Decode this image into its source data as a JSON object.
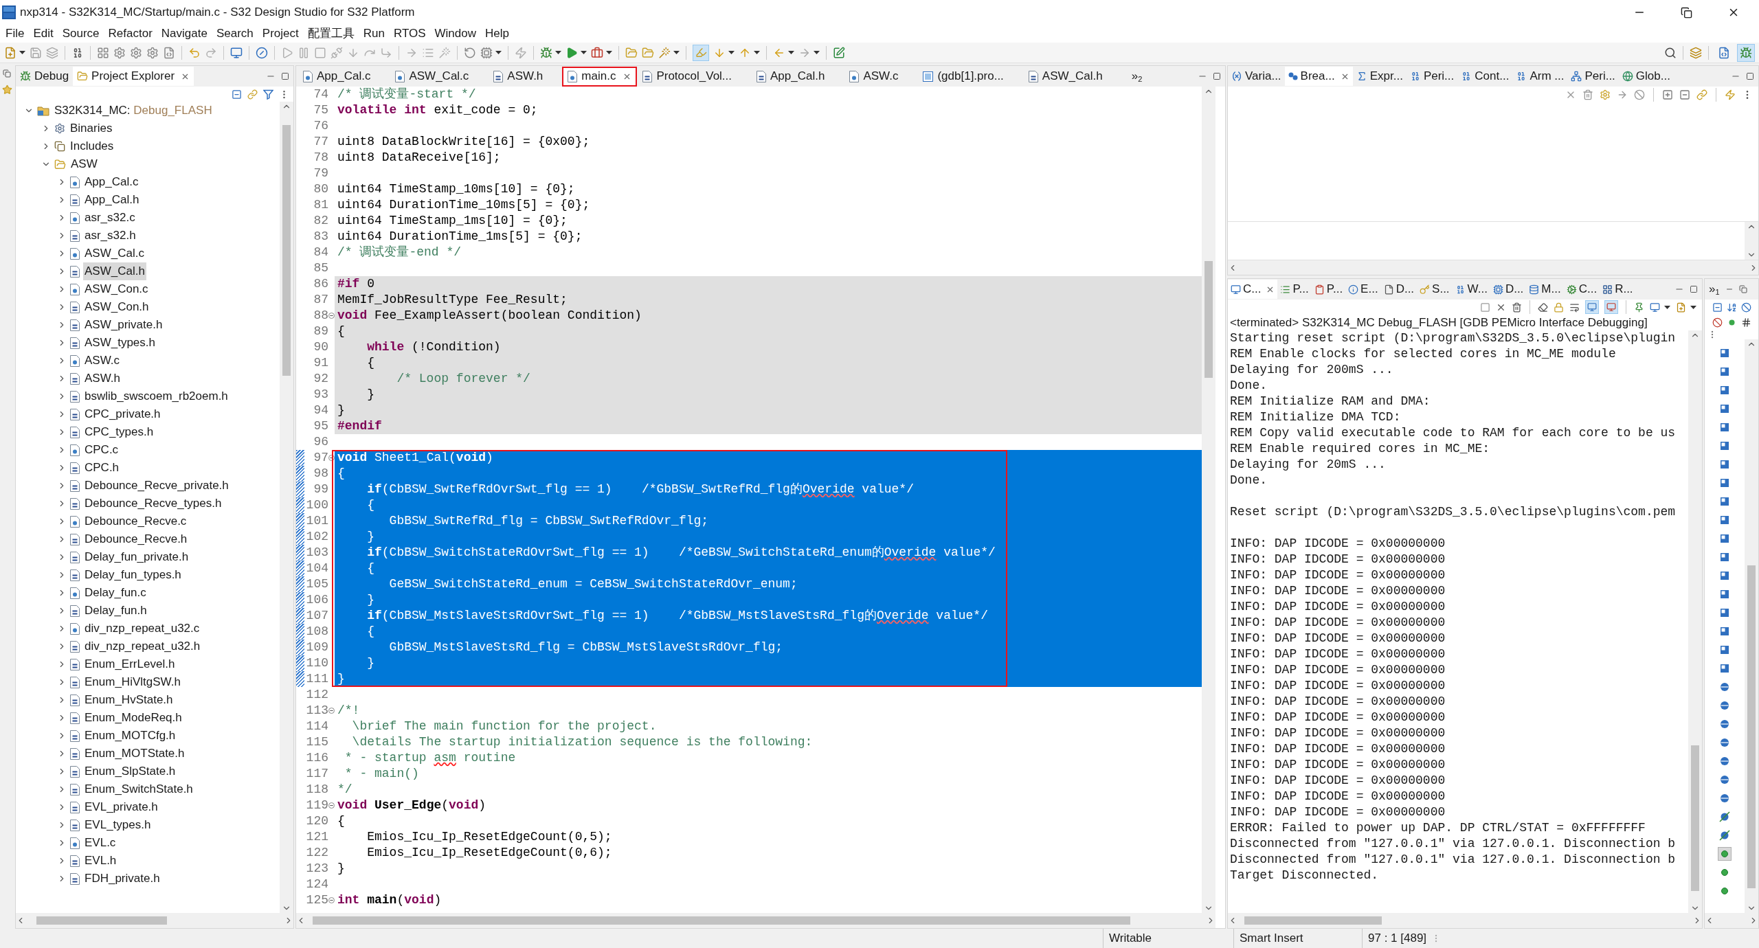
{
  "window": {
    "title": "nxp314 - S32K314_MC/Startup/main.c - S32 Design Studio for S32 Platform"
  },
  "menu": [
    "File",
    "Edit",
    "Source",
    "Refactor",
    "Navigate",
    "Search",
    "Project",
    "配置工具",
    "Run",
    "RTOS",
    "Window",
    "Help"
  ],
  "toolbar": {
    "highlight_toggle": {
      "on": true
    },
    "perspectives": [
      {
        "kind": "c-cpp",
        "selected": false
      },
      {
        "kind": "debug",
        "selected": true
      }
    ]
  },
  "left_panel": {
    "tabs": [
      {
        "label": "Debug",
        "kind": "debug",
        "selected": false
      },
      {
        "label": "Project Explorer",
        "kind": "explorer",
        "selected": true
      }
    ],
    "tree": [
      {
        "label": "S32K314_MC:",
        "config": "Debug_FLASH",
        "kind": "project",
        "expanded": true,
        "selected": false,
        "children": [
          {
            "label": "Binaries",
            "kind": "binaries",
            "expanded": false,
            "selected": false
          },
          {
            "label": "Includes",
            "kind": "includes",
            "expanded": false,
            "selected": false
          },
          {
            "label": "ASW",
            "kind": "folder",
            "expanded": true,
            "selected": false,
            "children": [
              {
                "label": "App_Cal.c",
                "kind": "c",
                "expanded": false,
                "selected": false
              },
              {
                "label": "App_Cal.h",
                "kind": "h",
                "expanded": false,
                "selected": false
              },
              {
                "label": "asr_s32.c",
                "kind": "c",
                "expanded": false,
                "selected": false
              },
              {
                "label": "asr_s32.h",
                "kind": "h",
                "expanded": false,
                "selected": false
              },
              {
                "label": "ASW_Cal.c",
                "kind": "c",
                "expanded": false,
                "selected": false
              },
              {
                "label": "ASW_Cal.h",
                "kind": "h",
                "expanded": false,
                "selected": true
              },
              {
                "label": "ASW_Con.c",
                "kind": "c",
                "expanded": false,
                "selected": false
              },
              {
                "label": "ASW_Con.h",
                "kind": "h",
                "expanded": false,
                "selected": false
              },
              {
                "label": "ASW_private.h",
                "kind": "h",
                "expanded": false,
                "selected": false
              },
              {
                "label": "ASW_types.h",
                "kind": "h",
                "expanded": false,
                "selected": false
              },
              {
                "label": "ASW.c",
                "kind": "c",
                "expanded": false,
                "selected": false
              },
              {
                "label": "ASW.h",
                "kind": "h",
                "expanded": false,
                "selected": false
              },
              {
                "label": "bswlib_swscoem_rb2oem.h",
                "kind": "h",
                "expanded": false,
                "selected": false
              },
              {
                "label": "CPC_private.h",
                "kind": "h",
                "expanded": false,
                "selected": false
              },
              {
                "label": "CPC_types.h",
                "kind": "h",
                "expanded": false,
                "selected": false
              },
              {
                "label": "CPC.c",
                "kind": "c",
                "expanded": false,
                "selected": false
              },
              {
                "label": "CPC.h",
                "kind": "h",
                "expanded": false,
                "selected": false
              },
              {
                "label": "Debounce_Recve_private.h",
                "kind": "h",
                "expanded": false,
                "selected": false
              },
              {
                "label": "Debounce_Recve_types.h",
                "kind": "h",
                "expanded": false,
                "selected": false
              },
              {
                "label": "Debounce_Recve.c",
                "kind": "c",
                "expanded": false,
                "selected": false
              },
              {
                "label": "Debounce_Recve.h",
                "kind": "h",
                "expanded": false,
                "selected": false
              },
              {
                "label": "Delay_fun_private.h",
                "kind": "h",
                "expanded": false,
                "selected": false
              },
              {
                "label": "Delay_fun_types.h",
                "kind": "h",
                "expanded": false,
                "selected": false
              },
              {
                "label": "Delay_fun.c",
                "kind": "c",
                "expanded": false,
                "selected": false
              },
              {
                "label": "Delay_fun.h",
                "kind": "h",
                "expanded": false,
                "selected": false
              },
              {
                "label": "div_nzp_repeat_u32.c",
                "kind": "c",
                "expanded": false,
                "selected": false
              },
              {
                "label": "div_nzp_repeat_u32.h",
                "kind": "h",
                "expanded": false,
                "selected": false
              },
              {
                "label": "Enum_ErrLevel.h",
                "kind": "h",
                "expanded": false,
                "selected": false
              },
              {
                "label": "Enum_HiVltgSW.h",
                "kind": "h",
                "expanded": false,
                "selected": false
              },
              {
                "label": "Enum_HvState.h",
                "kind": "h",
                "expanded": false,
                "selected": false
              },
              {
                "label": "Enum_ModeReq.h",
                "kind": "h",
                "expanded": false,
                "selected": false
              },
              {
                "label": "Enum_MOTCfg.h",
                "kind": "h",
                "expanded": false,
                "selected": false
              },
              {
                "label": "Enum_MOTState.h",
                "kind": "h",
                "expanded": false,
                "selected": false
              },
              {
                "label": "Enum_SlpState.h",
                "kind": "h",
                "expanded": false,
                "selected": false
              },
              {
                "label": "Enum_SwitchState.h",
                "kind": "h",
                "expanded": false,
                "selected": false
              },
              {
                "label": "EVL_private.h",
                "kind": "h",
                "expanded": false,
                "selected": false
              },
              {
                "label": "EVL_types.h",
                "kind": "h",
                "expanded": false,
                "selected": false
              },
              {
                "label": "EVL.c",
                "kind": "c",
                "expanded": false,
                "selected": false
              },
              {
                "label": "EVL.h",
                "kind": "h",
                "expanded": false,
                "selected": false
              },
              {
                "label": "FDH_private.h",
                "kind": "h",
                "expanded": false,
                "selected": false
              }
            ]
          }
        ]
      }
    ]
  },
  "editor": {
    "tabs": [
      {
        "label": "App_Cal.c",
        "kind": "c",
        "selected": false,
        "annotated": false
      },
      {
        "label": "ASW_Cal.c",
        "kind": "c",
        "selected": false,
        "annotated": false
      },
      {
        "label": "ASW.h",
        "kind": "h",
        "selected": false,
        "annotated": false
      },
      {
        "label": "main.c",
        "kind": "c",
        "selected": true,
        "annotated": true
      },
      {
        "label": "Protocol_Vol...",
        "kind": "h",
        "selected": false,
        "annotated": false
      },
      {
        "label": "App_Cal.h",
        "kind": "h",
        "selected": false,
        "annotated": false
      },
      {
        "label": "ASW.c",
        "kind": "c",
        "selected": false,
        "annotated": false
      },
      {
        "label": "(gdb[1].pro...",
        "kind": "launch",
        "selected": false,
        "annotated": false
      },
      {
        "label": "ASW_Cal.h",
        "kind": "h",
        "selected": false,
        "annotated": false
      }
    ],
    "overflow": {
      "symbol": "»",
      "count": "2"
    },
    "blocks": [
      {
        "annotated": false,
        "lines": [
          {
            "n": "74",
            "fold": false,
            "inactive": false,
            "selected": false,
            "segments": [
              {
                "kind": "comment",
                "text": "/* 调试变量-start */"
              }
            ]
          },
          {
            "n": "75",
            "fold": false,
            "inactive": false,
            "selected": false,
            "segments": [
              {
                "kind": "keyword",
                "text": "volatile int"
              },
              {
                "kind": "plain",
                "text": " exit_code = 0;"
              }
            ]
          },
          {
            "n": "76",
            "fold": false,
            "inactive": false,
            "selected": false
          },
          {
            "n": "77",
            "fold": false,
            "inactive": false,
            "selected": false,
            "segments": [
              {
                "kind": "plain",
                "text": "uint8 DataBlockWrite[16] = {0x00};"
              }
            ]
          },
          {
            "n": "78",
            "fold": false,
            "inactive": false,
            "selected": false,
            "segments": [
              {
                "kind": "plain",
                "text": "uint8 DataReceive[16];"
              }
            ]
          },
          {
            "n": "79",
            "fold": false,
            "inactive": false,
            "selected": false
          },
          {
            "n": "80",
            "fold": false,
            "inactive": false,
            "selected": false,
            "segments": [
              {
                "kind": "plain",
                "text": "uint64 TimeStamp_10ms[10] = {0};"
              }
            ]
          },
          {
            "n": "81",
            "fold": false,
            "inactive": false,
            "selected": false,
            "segments": [
              {
                "kind": "plain",
                "text": "uint64 DurationTime_10ms[5] = {0};"
              }
            ]
          },
          {
            "n": "82",
            "fold": false,
            "inactive": false,
            "selected": false,
            "segments": [
              {
                "kind": "plain",
                "text": "uint64 TimeStamp_1ms[10] = {0};"
              }
            ]
          },
          {
            "n": "83",
            "fold": false,
            "inactive": false,
            "selected": false,
            "segments": [
              {
                "kind": "plain",
                "text": "uint64 DurationTime_1ms[5] = {0};"
              }
            ]
          },
          {
            "n": "84",
            "fold": false,
            "inactive": false,
            "selected": false,
            "segments": [
              {
                "kind": "comment",
                "text": "/* 调试变量-end */"
              }
            ]
          },
          {
            "n": "85",
            "fold": false,
            "inactive": false,
            "selected": false
          },
          {
            "n": "86",
            "fold": false,
            "inactive": true,
            "selected": false,
            "segments": [
              {
                "kind": "keyword",
                "text": "#if"
              },
              {
                "kind": "plain",
                "text": " 0"
              }
            ]
          },
          {
            "n": "87",
            "fold": false,
            "inactive": true,
            "selected": false,
            "segments": [
              {
                "kind": "plain",
                "text": "MemIf_JobResultType Fee_Result;"
              }
            ]
          },
          {
            "n": "88",
            "fold": true,
            "inactive": true,
            "selected": false,
            "segments": [
              {
                "kind": "keyword",
                "text": "void"
              },
              {
                "kind": "plain",
                "text": " Fee_ExampleAssert(boolean Condition)"
              }
            ]
          },
          {
            "n": "89",
            "fold": false,
            "inactive": true,
            "selected": false,
            "segments": [
              {
                "kind": "plain",
                "text": "{"
              }
            ]
          },
          {
            "n": "90",
            "fold": false,
            "inactive": true,
            "selected": false,
            "segments": [
              {
                "kind": "keyword",
                "text": "    while"
              },
              {
                "kind": "plain",
                "text": " (!Condition)"
              }
            ]
          },
          {
            "n": "91",
            "fold": false,
            "inactive": true,
            "selected": false,
            "segments": [
              {
                "kind": "plain",
                "text": "    {"
              }
            ]
          },
          {
            "n": "92",
            "fold": false,
            "inactive": true,
            "selected": false,
            "segments": [
              {
                "kind": "comment",
                "text": "        /* Loop forever */"
              }
            ]
          },
          {
            "n": "93",
            "fold": false,
            "inactive": true,
            "selected": false,
            "segments": [
              {
                "kind": "plain",
                "text": "    }"
              }
            ]
          },
          {
            "n": "94",
            "fold": false,
            "inactive": true,
            "selected": false,
            "segments": [
              {
                "kind": "plain",
                "text": "}"
              }
            ]
          },
          {
            "n": "95",
            "fold": false,
            "inactive": true,
            "selected": false,
            "segments": [
              {
                "kind": "keyword",
                "text": "#endif"
              }
            ]
          },
          {
            "n": "96",
            "fold": false,
            "inactive": false,
            "selected": false
          }
        ]
      },
      {
        "annotated": true,
        "lines": [
          {
            "n": "97",
            "fold": true,
            "inactive": false,
            "selected": true,
            "segments": [
              {
                "kind": "keyword",
                "text": "void"
              },
              {
                "kind": "plain",
                "text": " Sheet1_Cal("
              },
              {
                "kind": "keyword",
                "text": "void"
              },
              {
                "kind": "plain",
                "text": ")"
              }
            ]
          },
          {
            "n": "98",
            "fold": false,
            "inactive": false,
            "selected": true,
            "segments": [
              {
                "kind": "plain",
                "text": "{"
              }
            ]
          },
          {
            "n": "99",
            "fold": false,
            "inactive": false,
            "selected": true,
            "segments": [
              {
                "kind": "keyword",
                "text": "    if"
              },
              {
                "kind": "plain",
                "text": "(CbBSW_SwtRefRdOvrSwt_flg == 1)    "
              },
              {
                "kind": "comment",
                "text": "/*GbBSW_SwtRefRd_flg的"
              },
              {
                "kind": "misspelled",
                "text": "Overide"
              },
              {
                "kind": "comment",
                "text": " value*/"
              }
            ]
          },
          {
            "n": "100",
            "fold": false,
            "inactive": false,
            "selected": true,
            "segments": [
              {
                "kind": "plain",
                "text": "    {"
              }
            ]
          },
          {
            "n": "101",
            "fold": false,
            "inactive": false,
            "selected": true,
            "segments": [
              {
                "kind": "plain",
                "text": "       GbBSW_SwtRefRd_flg = CbBSW_SwtRefRdOvr_flg;"
              }
            ]
          },
          {
            "n": "102",
            "fold": false,
            "inactive": false,
            "selected": true,
            "segments": [
              {
                "kind": "plain",
                "text": "    }"
              }
            ]
          },
          {
            "n": "103",
            "fold": false,
            "inactive": false,
            "selected": true,
            "segments": [
              {
                "kind": "keyword",
                "text": "    if"
              },
              {
                "kind": "plain",
                "text": "(CbBSW_SwitchStateRdOvrSwt_flg == 1)    "
              },
              {
                "kind": "comment",
                "text": "/*GeBSW_SwitchStateRd_enum的"
              },
              {
                "kind": "misspelled",
                "text": "Overide"
              },
              {
                "kind": "comment",
                "text": " value*/"
              }
            ]
          },
          {
            "n": "104",
            "fold": false,
            "inactive": false,
            "selected": true,
            "segments": [
              {
                "kind": "plain",
                "text": "    {"
              }
            ]
          },
          {
            "n": "105",
            "fold": false,
            "inactive": false,
            "selected": true,
            "segments": [
              {
                "kind": "plain",
                "text": "       GeBSW_SwitchStateRd_enum = CeBSW_SwitchStateRdOvr_enum;"
              }
            ]
          },
          {
            "n": "106",
            "fold": false,
            "inactive": false,
            "selected": true,
            "segments": [
              {
                "kind": "plain",
                "text": "    }"
              }
            ]
          },
          {
            "n": "107",
            "fold": false,
            "inactive": false,
            "selected": true,
            "segments": [
              {
                "kind": "keyword",
                "text": "    if"
              },
              {
                "kind": "plain",
                "text": "(CbBSW_MstSlaveStsRdOvrSwt_flg == 1)    "
              },
              {
                "kind": "comment",
                "text": "/*GbBSW_MstSlaveStsRd_flg的"
              },
              {
                "kind": "misspelled",
                "text": "Overide"
              },
              {
                "kind": "comment",
                "text": " value*/"
              }
            ]
          },
          {
            "n": "108",
            "fold": false,
            "inactive": false,
            "selected": true,
            "segments": [
              {
                "kind": "plain",
                "text": "    {"
              }
            ]
          },
          {
            "n": "109",
            "fold": false,
            "inactive": false,
            "selected": true,
            "segments": [
              {
                "kind": "plain",
                "text": "       GbBSW_MstSlaveStsRd_flg = CbBSW_MstSlaveStsRdOvr_flg;"
              }
            ]
          },
          {
            "n": "110",
            "fold": false,
            "inactive": false,
            "selected": true,
            "segments": [
              {
                "kind": "plain",
                "text": "    }"
              }
            ]
          },
          {
            "n": "111",
            "fold": false,
            "inactive": false,
            "selected": true,
            "segments": [
              {
                "kind": "plain",
                "text": "}"
              }
            ]
          }
        ]
      },
      {
        "annotated": false,
        "lines": [
          {
            "n": "112",
            "fold": false,
            "inactive": false,
            "selected": false
          },
          {
            "n": "113",
            "fold": true,
            "inactive": false,
            "selected": false,
            "segments": [
              {
                "kind": "comment",
                "text": "/*!"
              }
            ]
          },
          {
            "n": "114",
            "fold": false,
            "inactive": false,
            "selected": false,
            "segments": [
              {
                "kind": "comment",
                "text": "  \\brief The main function for the project."
              }
            ]
          },
          {
            "n": "115",
            "fold": false,
            "inactive": false,
            "selected": false,
            "segments": [
              {
                "kind": "comment",
                "text": "  \\details The startup initialization sequence is the following:"
              }
            ]
          },
          {
            "n": "116",
            "fold": false,
            "inactive": false,
            "selected": false,
            "segments": [
              {
                "kind": "comment",
                "text": " * - startup "
              },
              {
                "kind": "misspelled",
                "text": "asm"
              },
              {
                "kind": "comment",
                "text": " routine"
              }
            ]
          },
          {
            "n": "117",
            "fold": false,
            "inactive": false,
            "selected": false,
            "segments": [
              {
                "kind": "comment",
                "text": " * - main()"
              }
            ]
          },
          {
            "n": "118",
            "fold": false,
            "inactive": false,
            "selected": false,
            "segments": [
              {
                "kind": "comment",
                "text": "*/"
              }
            ]
          },
          {
            "n": "119",
            "fold": true,
            "inactive": false,
            "selected": false,
            "segments": [
              {
                "kind": "keyword",
                "text": "void"
              },
              {
                "kind": "name",
                "text": " User_Edge"
              },
              {
                "kind": "plain",
                "text": "("
              },
              {
                "kind": "keyword",
                "text": "void"
              },
              {
                "kind": "plain",
                "text": ")"
              }
            ]
          },
          {
            "n": "120",
            "fold": false,
            "inactive": false,
            "selected": false,
            "segments": [
              {
                "kind": "plain",
                "text": "{"
              }
            ]
          },
          {
            "n": "121",
            "fold": false,
            "inactive": false,
            "selected": false,
            "segments": [
              {
                "kind": "plain",
                "text": "    Emios_Icu_Ip_ResetEdgeCount(0,5);"
              }
            ]
          },
          {
            "n": "122",
            "fold": false,
            "inactive": false,
            "selected": false,
            "segments": [
              {
                "kind": "plain",
                "text": "    Emios_Icu_Ip_ResetEdgeCount(0,6);"
              }
            ]
          },
          {
            "n": "123",
            "fold": false,
            "inactive": false,
            "selected": false,
            "segments": [
              {
                "kind": "plain",
                "text": "}"
              }
            ]
          },
          {
            "n": "124",
            "fold": false,
            "inactive": false,
            "selected": false
          },
          {
            "n": "125",
            "fold": true,
            "inactive": false,
            "selected": false,
            "segments": [
              {
                "kind": "keyword",
                "text": "int"
              },
              {
                "kind": "name",
                "text": " main"
              },
              {
                "kind": "plain",
                "text": "("
              },
              {
                "kind": "keyword",
                "text": "void"
              },
              {
                "kind": "plain",
                "text": ")"
              }
            ]
          }
        ]
      }
    ]
  },
  "debug_views": {
    "tabs": [
      {
        "label": "Varia...",
        "kind": "variables",
        "selected": false
      },
      {
        "label": "Brea...",
        "kind": "breakpoints",
        "selected": true
      },
      {
        "label": "Expr...",
        "kind": "expressions",
        "selected": false
      },
      {
        "label": "Peri...",
        "kind": "registers",
        "selected": false
      },
      {
        "label": "Cont...",
        "kind": "registers",
        "selected": false
      },
      {
        "label": "Arm ...",
        "kind": "registers",
        "selected": false
      },
      {
        "label": "Peri...",
        "kind": "tree",
        "selected": false
      },
      {
        "label": "Glob...",
        "kind": "globals",
        "selected": false
      }
    ]
  },
  "console_view": {
    "tabs": [
      {
        "label": "C...",
        "kind": "console",
        "selected": true
      },
      {
        "label": "P...",
        "kind": "problems",
        "selected": false
      },
      {
        "label": "P...",
        "kind": "properties",
        "selected": false
      },
      {
        "label": "E...",
        "kind": "errors",
        "selected": false
      },
      {
        "label": "D...",
        "kind": "docs",
        "selected": false
      },
      {
        "label": "S...",
        "kind": "search",
        "selected": false
      },
      {
        "label": "W...",
        "kind": "memory",
        "selected": false
      },
      {
        "label": "D...",
        "kind": "debugger",
        "selected": false
      },
      {
        "label": "M...",
        "kind": "modules",
        "selected": false
      },
      {
        "label": "C...",
        "kind": "cores",
        "selected": false
      },
      {
        "label": "R...",
        "kind": "registers",
        "selected": false
      }
    ],
    "output_toggles": [
      {
        "on": true
      },
      {
        "on": true
      }
    ],
    "header": "<terminated> S32K314_MC Debug_FLASH [GDB PEMicro Interface Debugging]",
    "lines": [
      {
        "kind": "text",
        "text": "Starting reset script (D:\\program\\S32DS_3.5.0\\eclipse\\plugin"
      },
      {
        "kind": "text",
        "text": "REM Enable clocks for selected cores in MC_ME module"
      },
      {
        "kind": "text",
        "text": "Delaying for 200mS ..."
      },
      {
        "kind": "text",
        "text": "Done."
      },
      {
        "kind": "text",
        "text": "REM Initialize RAM and DMA:"
      },
      {
        "kind": "text",
        "text": "REM Initialize DMA TCD:"
      },
      {
        "kind": "text",
        "text": "REM Copy valid executable code to RAM for each core to be us"
      },
      {
        "kind": "text",
        "text": "REM Enable required cores in MC_ME:"
      },
      {
        "kind": "text",
        "text": "Delaying for 20mS ..."
      },
      {
        "kind": "text",
        "text": "Done."
      },
      {
        "kind": "blank"
      },
      {
        "kind": "text",
        "text": "Reset script (D:\\program\\S32DS_3.5.0\\eclipse\\plugins\\com.pem"
      },
      {
        "kind": "blank"
      },
      {
        "kind": "text",
        "text": "INFO: DAP IDCODE = 0x00000000"
      },
      {
        "kind": "text",
        "text": "INFO: DAP IDCODE = 0x00000000"
      },
      {
        "kind": "text",
        "text": "INFO: DAP IDCODE = 0x00000000"
      },
      {
        "kind": "text",
        "text": "INFO: DAP IDCODE = 0x00000000"
      },
      {
        "kind": "text",
        "text": "INFO: DAP IDCODE = 0x00000000"
      },
      {
        "kind": "text",
        "text": "INFO: DAP IDCODE = 0x00000000"
      },
      {
        "kind": "text",
        "text": "INFO: DAP IDCODE = 0x00000000"
      },
      {
        "kind": "text",
        "text": "INFO: DAP IDCODE = 0x00000000"
      },
      {
        "kind": "text",
        "text": "INFO: DAP IDCODE = 0x00000000"
      },
      {
        "kind": "text",
        "text": "INFO: DAP IDCODE = 0x00000000"
      },
      {
        "kind": "text",
        "text": "INFO: DAP IDCODE = 0x00000000"
      },
      {
        "kind": "text",
        "text": "INFO: DAP IDCODE = 0x00000000"
      },
      {
        "kind": "text",
        "text": "INFO: DAP IDCODE = 0x00000000"
      },
      {
        "kind": "text",
        "text": "INFO: DAP IDCODE = 0x00000000"
      },
      {
        "kind": "text",
        "text": "INFO: DAP IDCODE = 0x00000000"
      },
      {
        "kind": "text",
        "text": "INFO: DAP IDCODE = 0x00000000"
      },
      {
        "kind": "text",
        "text": "INFO: DAP IDCODE = 0x00000000"
      },
      {
        "kind": "text",
        "text": "INFO: DAP IDCODE = 0x00000000"
      },
      {
        "kind": "text",
        "text": "ERROR: Failed to power up DAP. DP CTRL/STAT = 0xFFFFFFFF"
      },
      {
        "kind": "text",
        "text": "Disconnected from \"127.0.0.1\" via 127.0.0.1. Disconnection b"
      },
      {
        "kind": "text",
        "text": "Disconnected from \"127.0.0.1\" via 127.0.0.1. Disconnection b"
      },
      {
        "kind": "text",
        "text": "Target Disconnected."
      }
    ]
  },
  "outline_strip": {
    "overflow": {
      "symbol": "»",
      "count": "1"
    },
    "items": [
      {
        "kind": "variable",
        "selected": false
      },
      {
        "kind": "variable",
        "selected": false
      },
      {
        "kind": "variable",
        "selected": false
      },
      {
        "kind": "variable",
        "selected": false
      },
      {
        "kind": "variable",
        "selected": false
      },
      {
        "kind": "variable",
        "selected": false
      },
      {
        "kind": "variable",
        "selected": false
      },
      {
        "kind": "variable",
        "selected": false
      },
      {
        "kind": "variable",
        "selected": false
      },
      {
        "kind": "variable",
        "selected": false
      },
      {
        "kind": "variable",
        "selected": false
      },
      {
        "kind": "variable",
        "selected": false
      },
      {
        "kind": "variable",
        "selected": false
      },
      {
        "kind": "variable",
        "selected": false
      },
      {
        "kind": "variable",
        "selected": false
      },
      {
        "kind": "variable",
        "selected": false
      },
      {
        "kind": "variable",
        "selected": false
      },
      {
        "kind": "variable",
        "selected": false
      },
      {
        "kind": "function",
        "selected": false
      },
      {
        "kind": "function",
        "selected": false
      },
      {
        "kind": "function",
        "selected": false
      },
      {
        "kind": "function",
        "selected": false
      },
      {
        "kind": "function",
        "selected": false
      },
      {
        "kind": "function",
        "selected": false
      },
      {
        "kind": "function",
        "selected": false
      },
      {
        "kind": "declaration",
        "selected": false
      },
      {
        "kind": "declaration",
        "selected": false
      },
      {
        "kind": "public-function",
        "selected": true
      },
      {
        "kind": "public-function",
        "selected": false
      },
      {
        "kind": "public-function",
        "selected": false
      }
    ]
  },
  "status_bar": {
    "fields": [
      "Writable",
      "Smart Insert",
      "97 : 1 [489]"
    ]
  }
}
